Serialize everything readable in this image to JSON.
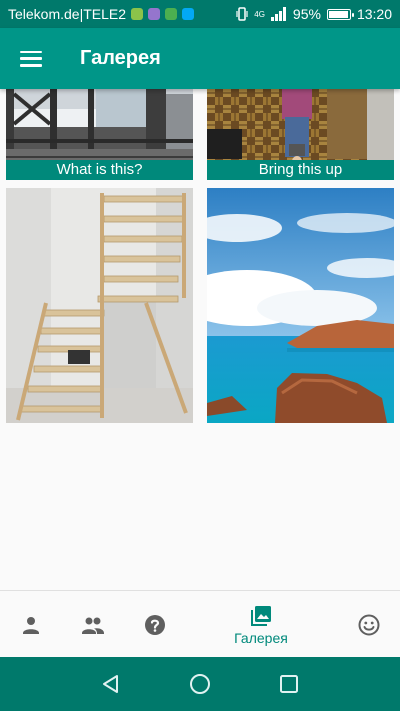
{
  "status_bar": {
    "carrier": "Telekom.de|TELE2",
    "battery_text": "95%",
    "battery_level": 0.95,
    "time": "13:20",
    "network_label": "4G"
  },
  "app_bar": {
    "title": "Галерея"
  },
  "gallery": {
    "items": [
      {
        "caption": "What is this?",
        "icon": "photo-snowy-deck"
      },
      {
        "caption": "Bring this up",
        "icon": "photo-child-parquet"
      },
      {
        "caption": "",
        "icon": "photo-wooden-staircase"
      },
      {
        "caption": "",
        "icon": "photo-sea-rocks"
      }
    ]
  },
  "bottom_nav": {
    "items": [
      {
        "icon": "person-icon",
        "label": ""
      },
      {
        "icon": "group-icon",
        "label": ""
      },
      {
        "icon": "help-icon",
        "label": ""
      },
      {
        "icon": "gallery-icon",
        "label": "Галерея",
        "active": true
      },
      {
        "icon": "smiley-icon",
        "label": ""
      }
    ]
  },
  "colors": {
    "primary": "#009688",
    "primary_dark": "#00796b",
    "caption_bg": "#00897b",
    "active_nav": "#00897b",
    "inactive_nav": "#5f5f5f"
  }
}
